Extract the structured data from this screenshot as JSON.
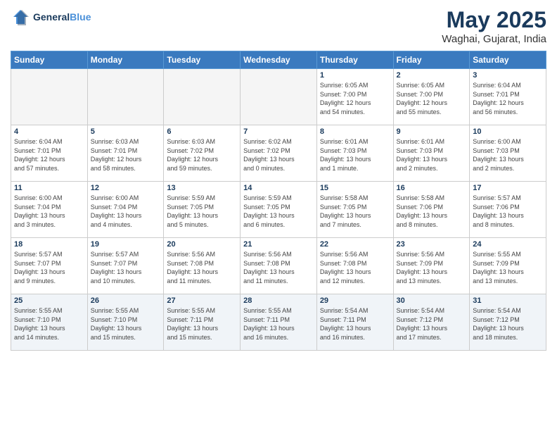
{
  "header": {
    "logo_line1": "General",
    "logo_line2": "Blue",
    "title": "May 2025",
    "location": "Waghai, Gujarat, India"
  },
  "days_of_week": [
    "Sunday",
    "Monday",
    "Tuesday",
    "Wednesday",
    "Thursday",
    "Friday",
    "Saturday"
  ],
  "weeks": [
    [
      {
        "day": "",
        "info": ""
      },
      {
        "day": "",
        "info": ""
      },
      {
        "day": "",
        "info": ""
      },
      {
        "day": "",
        "info": ""
      },
      {
        "day": "1",
        "info": "Sunrise: 6:05 AM\nSunset: 7:00 PM\nDaylight: 12 hours\nand 54 minutes."
      },
      {
        "day": "2",
        "info": "Sunrise: 6:05 AM\nSunset: 7:00 PM\nDaylight: 12 hours\nand 55 minutes."
      },
      {
        "day": "3",
        "info": "Sunrise: 6:04 AM\nSunset: 7:01 PM\nDaylight: 12 hours\nand 56 minutes."
      }
    ],
    [
      {
        "day": "4",
        "info": "Sunrise: 6:04 AM\nSunset: 7:01 PM\nDaylight: 12 hours\nand 57 minutes."
      },
      {
        "day": "5",
        "info": "Sunrise: 6:03 AM\nSunset: 7:01 PM\nDaylight: 12 hours\nand 58 minutes."
      },
      {
        "day": "6",
        "info": "Sunrise: 6:03 AM\nSunset: 7:02 PM\nDaylight: 12 hours\nand 59 minutes."
      },
      {
        "day": "7",
        "info": "Sunrise: 6:02 AM\nSunset: 7:02 PM\nDaylight: 13 hours\nand 0 minutes."
      },
      {
        "day": "8",
        "info": "Sunrise: 6:01 AM\nSunset: 7:03 PM\nDaylight: 13 hours\nand 1 minute."
      },
      {
        "day": "9",
        "info": "Sunrise: 6:01 AM\nSunset: 7:03 PM\nDaylight: 13 hours\nand 2 minutes."
      },
      {
        "day": "10",
        "info": "Sunrise: 6:00 AM\nSunset: 7:03 PM\nDaylight: 13 hours\nand 2 minutes."
      }
    ],
    [
      {
        "day": "11",
        "info": "Sunrise: 6:00 AM\nSunset: 7:04 PM\nDaylight: 13 hours\nand 3 minutes."
      },
      {
        "day": "12",
        "info": "Sunrise: 6:00 AM\nSunset: 7:04 PM\nDaylight: 13 hours\nand 4 minutes."
      },
      {
        "day": "13",
        "info": "Sunrise: 5:59 AM\nSunset: 7:05 PM\nDaylight: 13 hours\nand 5 minutes."
      },
      {
        "day": "14",
        "info": "Sunrise: 5:59 AM\nSunset: 7:05 PM\nDaylight: 13 hours\nand 6 minutes."
      },
      {
        "day": "15",
        "info": "Sunrise: 5:58 AM\nSunset: 7:05 PM\nDaylight: 13 hours\nand 7 minutes."
      },
      {
        "day": "16",
        "info": "Sunrise: 5:58 AM\nSunset: 7:06 PM\nDaylight: 13 hours\nand 8 minutes."
      },
      {
        "day": "17",
        "info": "Sunrise: 5:57 AM\nSunset: 7:06 PM\nDaylight: 13 hours\nand 8 minutes."
      }
    ],
    [
      {
        "day": "18",
        "info": "Sunrise: 5:57 AM\nSunset: 7:07 PM\nDaylight: 13 hours\nand 9 minutes."
      },
      {
        "day": "19",
        "info": "Sunrise: 5:57 AM\nSunset: 7:07 PM\nDaylight: 13 hours\nand 10 minutes."
      },
      {
        "day": "20",
        "info": "Sunrise: 5:56 AM\nSunset: 7:08 PM\nDaylight: 13 hours\nand 11 minutes."
      },
      {
        "day": "21",
        "info": "Sunrise: 5:56 AM\nSunset: 7:08 PM\nDaylight: 13 hours\nand 11 minutes."
      },
      {
        "day": "22",
        "info": "Sunrise: 5:56 AM\nSunset: 7:08 PM\nDaylight: 13 hours\nand 12 minutes."
      },
      {
        "day": "23",
        "info": "Sunrise: 5:56 AM\nSunset: 7:09 PM\nDaylight: 13 hours\nand 13 minutes."
      },
      {
        "day": "24",
        "info": "Sunrise: 5:55 AM\nSunset: 7:09 PM\nDaylight: 13 hours\nand 13 minutes."
      }
    ],
    [
      {
        "day": "25",
        "info": "Sunrise: 5:55 AM\nSunset: 7:10 PM\nDaylight: 13 hours\nand 14 minutes."
      },
      {
        "day": "26",
        "info": "Sunrise: 5:55 AM\nSunset: 7:10 PM\nDaylight: 13 hours\nand 15 minutes."
      },
      {
        "day": "27",
        "info": "Sunrise: 5:55 AM\nSunset: 7:11 PM\nDaylight: 13 hours\nand 15 minutes."
      },
      {
        "day": "28",
        "info": "Sunrise: 5:55 AM\nSunset: 7:11 PM\nDaylight: 13 hours\nand 16 minutes."
      },
      {
        "day": "29",
        "info": "Sunrise: 5:54 AM\nSunset: 7:11 PM\nDaylight: 13 hours\nand 16 minutes."
      },
      {
        "day": "30",
        "info": "Sunrise: 5:54 AM\nSunset: 7:12 PM\nDaylight: 13 hours\nand 17 minutes."
      },
      {
        "day": "31",
        "info": "Sunrise: 5:54 AM\nSunset: 7:12 PM\nDaylight: 13 hours\nand 18 minutes."
      }
    ]
  ]
}
